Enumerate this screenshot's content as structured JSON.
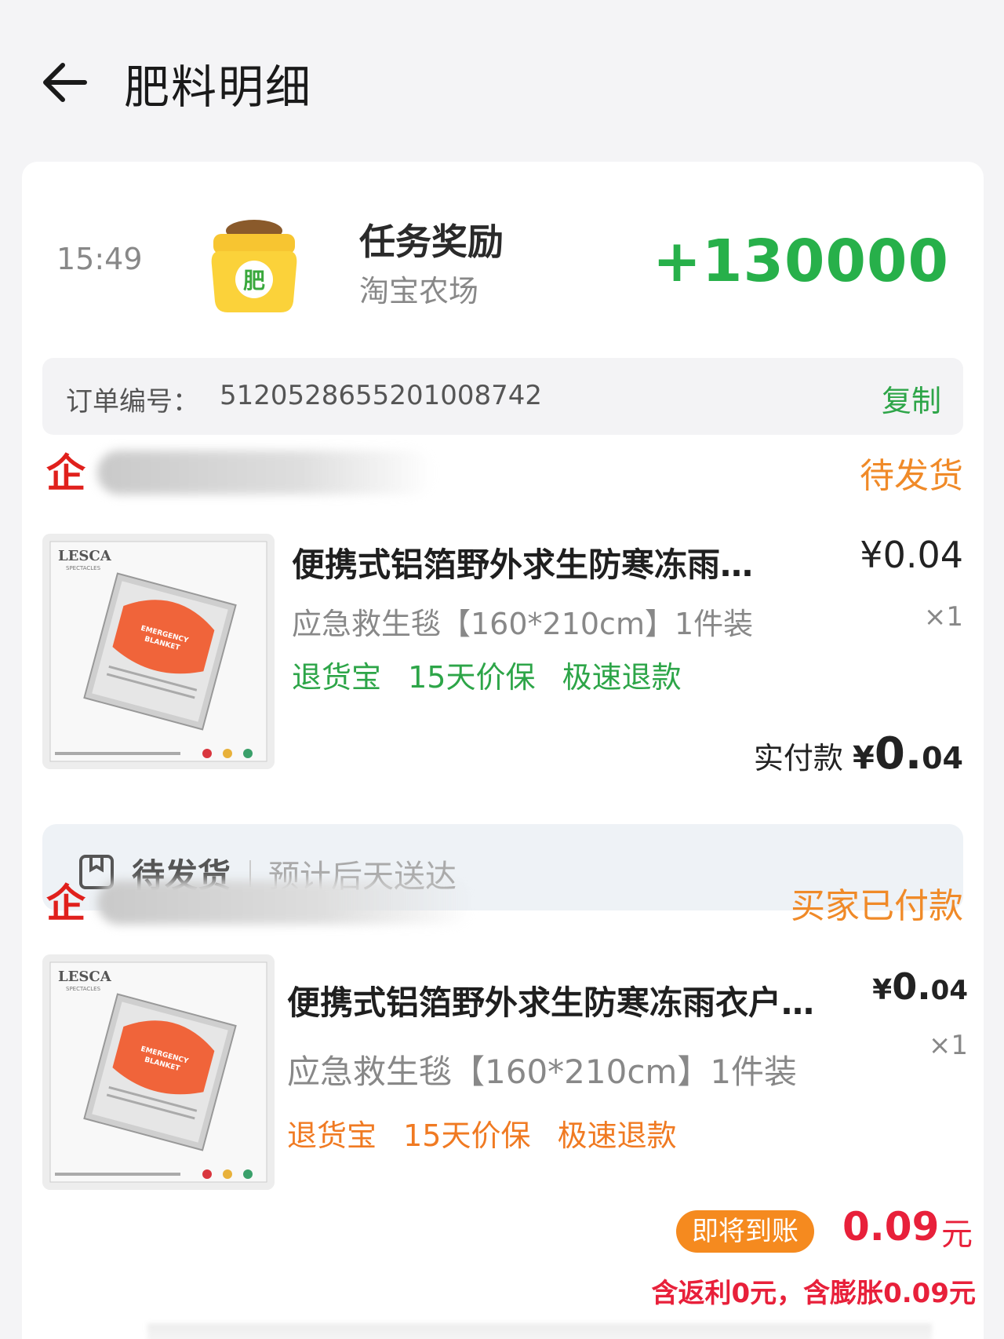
{
  "header": {
    "title": "肥料明细"
  },
  "reward": {
    "time": "15:49",
    "icon_label": "肥",
    "title": "任务奖励",
    "source": "淘宝农场",
    "amount": "+130000"
  },
  "order": {
    "label": "订单编号：",
    "number": "5120528655201008742",
    "copy_label": "复制"
  },
  "shop1": {
    "icon_char": "企",
    "status": "待发货"
  },
  "product1": {
    "title": "便携式铝箔野外求生防寒冻雨…",
    "price": "¥0.04",
    "sku": "应急救生毯【160*210cm】1件装",
    "qty": "×1",
    "tags": [
      "退货宝",
      "15天价保",
      "极速退款"
    ],
    "paid_label": "实付款",
    "paid_yen": "¥",
    "paid_int": "0.",
    "paid_dec": "04"
  },
  "delivery": {
    "status": "待发货",
    "eta": "预计后天送达"
  },
  "shop2": {
    "icon_char": "企",
    "status": "买家已付款"
  },
  "product2": {
    "title": "便携式铝箔野外求生防寒冻雨衣户…",
    "price_yen": "¥",
    "price_int": "0.",
    "price_dec": "04",
    "sku": "应急救生毯【160*210cm】1件装",
    "qty": "×1",
    "tags": [
      "退货宝",
      "15天价保",
      "极速退款"
    ]
  },
  "image_brand": {
    "name": "LESCA",
    "sub": "SPECTACLES"
  },
  "bottom": {
    "badge": "即将到账",
    "amount": "0.09",
    "unit": "元",
    "note": "含返利0元，含膨胀0.09元"
  },
  "colors": {
    "green": "#27b04a",
    "orange": "#f08a28",
    "red": "#e8203a",
    "brand_red": "#e0201c"
  }
}
